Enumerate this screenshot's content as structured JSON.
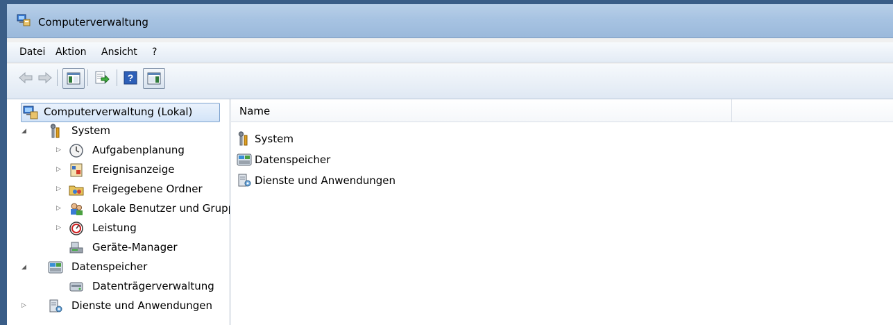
{
  "window": {
    "title": "Computerverwaltung"
  },
  "menu": [
    "Datei",
    "Aktion",
    "Ansicht",
    "?"
  ],
  "toolbar": {
    "buttons": [
      "back-icon",
      "forward-icon",
      "show-hide-console-tree-icon",
      "export-list-icon",
      "help-icon",
      "show-hide-action-pane-icon"
    ]
  },
  "tree": {
    "root": "Computerverwaltung (Lokal)",
    "system": "System",
    "system_children": [
      "Aufgabenplanung",
      "Ereignisanzeige",
      "Freigegebene Ordner",
      "Lokale Benutzer und Gruppen",
      "Leistung",
      "Geräte-Manager"
    ],
    "storage": "Datenspeicher",
    "storage_children": [
      "Datenträgerverwaltung"
    ],
    "services": "Dienste und Anwendungen"
  },
  "list": {
    "column": "Name",
    "items": [
      "System",
      "Datenspeicher",
      "Dienste und Anwendungen"
    ]
  }
}
